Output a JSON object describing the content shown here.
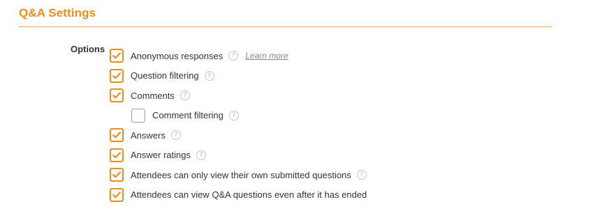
{
  "section": {
    "title": "Q&A Settings",
    "accent_color": "#f08c1e"
  },
  "options": {
    "label": "Options",
    "help_icon_glyph": "?",
    "items": [
      {
        "label": "Anonymous responses",
        "checked": true,
        "help": true,
        "link": "Learn more",
        "nested": false
      },
      {
        "label": "Question filtering",
        "checked": true,
        "help": true,
        "nested": false
      },
      {
        "label": "Comments",
        "checked": true,
        "help": true,
        "nested": false
      },
      {
        "label": "Comment filtering",
        "checked": false,
        "help": true,
        "nested": true
      },
      {
        "label": "Answers",
        "checked": true,
        "help": true,
        "nested": false
      },
      {
        "label": "Answer ratings",
        "checked": true,
        "help": true,
        "nested": false
      },
      {
        "label": "Attendees can only view their own submitted questions",
        "checked": true,
        "help": true,
        "nested": false
      },
      {
        "label": "Attendees can view Q&A questions even after it has ended",
        "checked": true,
        "help": false,
        "nested": false
      }
    ]
  }
}
